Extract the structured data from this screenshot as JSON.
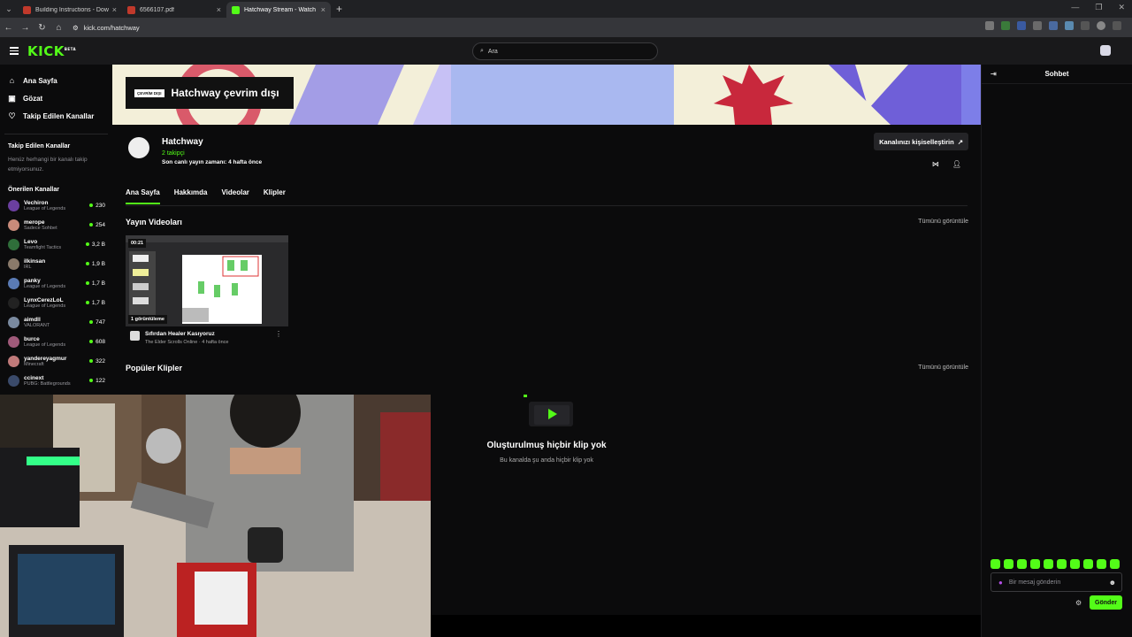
{
  "browser": {
    "tabs": [
      {
        "title": "Building Instructions - Downlo",
        "active": false
      },
      {
        "title": "6566107.pdf",
        "active": false
      },
      {
        "title": "Hatchway Stream - Watch Live",
        "active": true
      }
    ],
    "new_tab": "+",
    "url": "kick.com/hatchway"
  },
  "header": {
    "logo": "KICK",
    "logo_badge": "BETA",
    "search_placeholder": "Ara"
  },
  "sidebar": {
    "nav": [
      {
        "label": "Ana Sayfa",
        "icon": "home-icon"
      },
      {
        "label": "Gözat",
        "icon": "browse-icon"
      },
      {
        "label": "Takip Edilen Kanallar",
        "icon": "heart-icon"
      }
    ],
    "followed_title": "Takip Edilen Kanallar",
    "followed_note": "Henüz herhangi bir kanalı takip etmiyorsunuz.",
    "recommended_title": "Önerilen Kanallar",
    "channels": [
      {
        "name": "Vechiron",
        "category": "League of Legends",
        "viewers": "230",
        "color": "#6b3fa0"
      },
      {
        "name": "merope",
        "category": "Sadece Sohbet",
        "viewers": "254",
        "color": "#c98b7a"
      },
      {
        "name": "Levo",
        "category": "Teamfight Tactics",
        "viewers": "3,2 B",
        "color": "#2f6e3a"
      },
      {
        "name": "ilkinsan",
        "category": "IRL",
        "viewers": "1,9 B",
        "color": "#8a7a6a"
      },
      {
        "name": "panky",
        "category": "League of Legends",
        "viewers": "1,7 B",
        "color": "#5a7bb5"
      },
      {
        "name": "LynxCerezLoL",
        "category": "League of Legends",
        "viewers": "1,7 B",
        "color": "#222"
      },
      {
        "name": "aimdll",
        "category": "VALORANT",
        "viewers": "747",
        "color": "#7a8aa0"
      },
      {
        "name": "burce",
        "category": "League of Legends",
        "viewers": "608",
        "color": "#a05a7a"
      },
      {
        "name": "yandereyagmur",
        "category": "Minecraft",
        "viewers": "322",
        "color": "#c07a7a"
      },
      {
        "name": "ccinext",
        "category": "PUBG: Battlegrounds",
        "viewers": "122",
        "color": "#3a4a6a"
      }
    ]
  },
  "channel": {
    "offline_tag": "ÇEVRİM DIŞI",
    "offline_text": "Hatchway çevrim dışı",
    "name": "Hatchway",
    "followers": "2 takipçi",
    "last_live": "Son canlı yayın zamanı: 4 hafta önce",
    "customize": "Kanalınızı kişiselleştirin",
    "tabs": [
      "Ana Sayfa",
      "Hakkımda",
      "Videolar",
      "Klipler"
    ]
  },
  "videos_section": {
    "title": "Yayın Videoları",
    "see_all": "Tümünü görüntüle",
    "items": [
      {
        "duration": "00:21",
        "views": "1 görüntüleme",
        "title": "Sıfırdan Healer Kasıyoruz",
        "game": "The Elder Scrolls Online · 4 hafta önce"
      }
    ]
  },
  "clips_section": {
    "title": "Popüler Klipler",
    "see_all": "Tümünü görüntüle",
    "empty_title": "Oluşturulmuş hiçbir klip yok",
    "empty_sub": "Bu kanalda şu anda hiçbir klip yok"
  },
  "chat": {
    "title": "Sohbet",
    "placeholder": "Bir mesaj gönderin",
    "send": "Gönder"
  },
  "colors": {
    "accent": "#53fc18",
    "background": "#0b0b0c"
  }
}
